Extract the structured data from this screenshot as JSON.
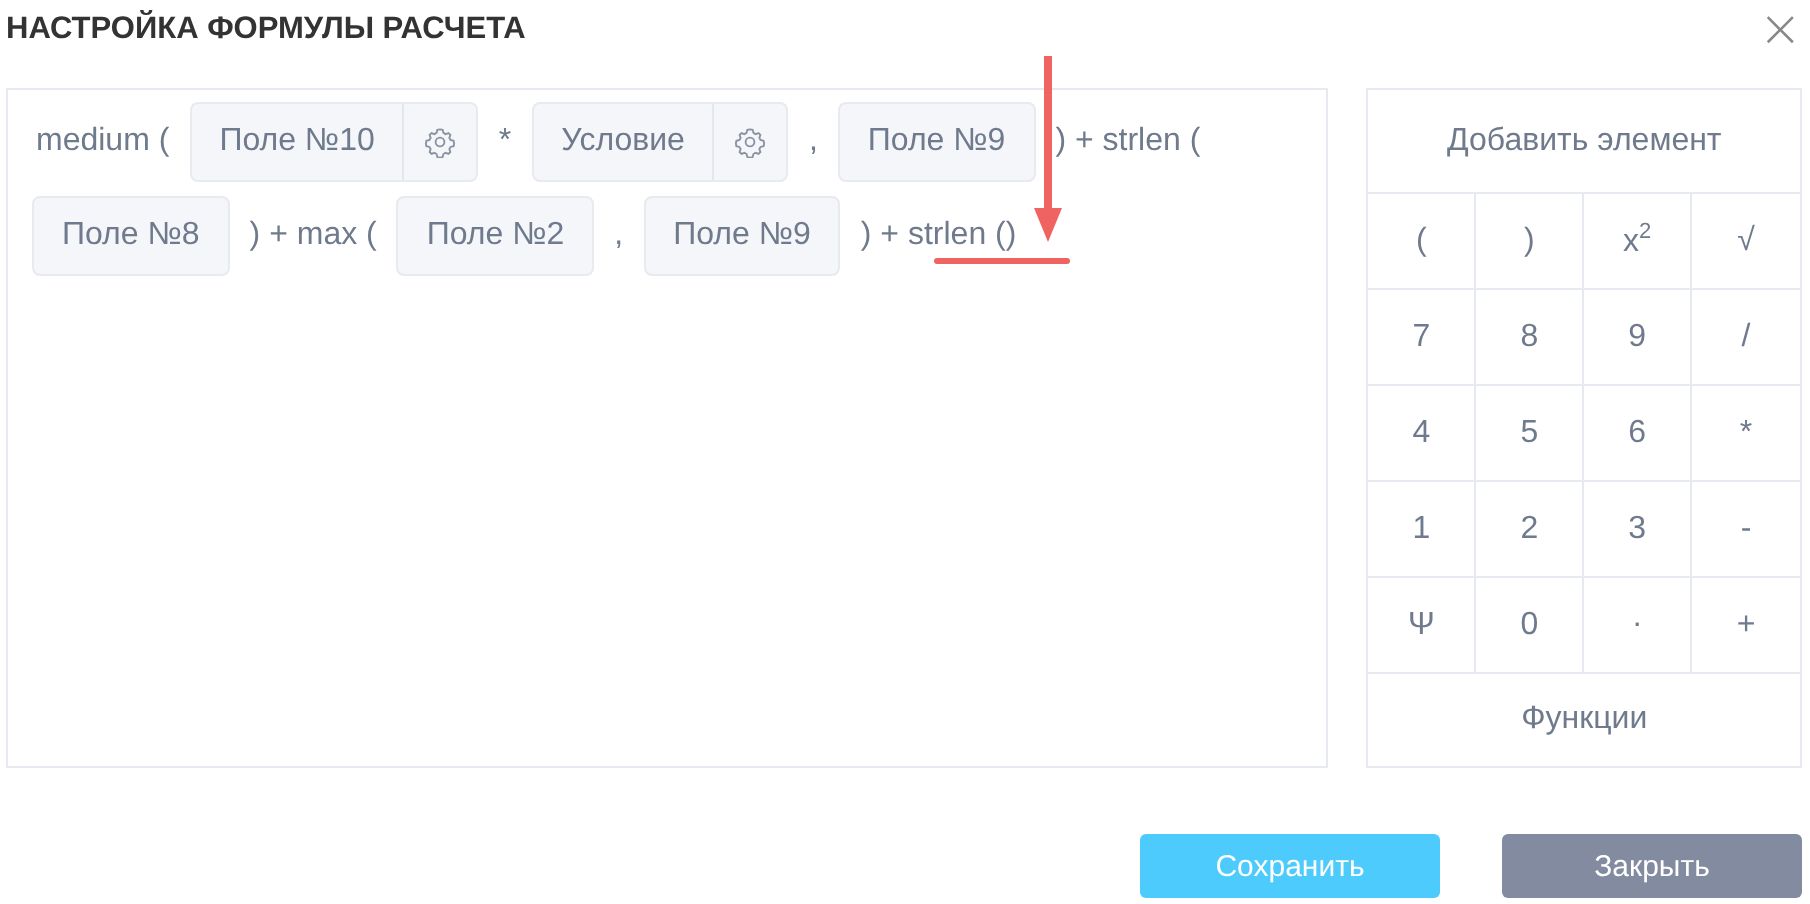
{
  "dialog": {
    "title": "НАСТРОЙКА ФОРМУЛЫ РАСЧЕТА",
    "close": "×"
  },
  "formula": [
    {
      "kind": "text",
      "text": "medium ("
    },
    {
      "kind": "field",
      "text": "Поле №10",
      "settings": true
    },
    {
      "kind": "text",
      "text": "*"
    },
    {
      "kind": "field",
      "text": "Условие",
      "settings": true
    },
    {
      "kind": "text",
      "text": ","
    },
    {
      "kind": "field",
      "text": "Поле №9",
      "settings": false
    },
    {
      "kind": "text",
      "text": ") + strlen ("
    },
    {
      "kind": "field",
      "text": "Поле №8",
      "settings": false
    },
    {
      "kind": "text",
      "text": ") + max ("
    },
    {
      "kind": "field",
      "text": "Поле №2",
      "settings": false
    },
    {
      "kind": "text",
      "text": ","
    },
    {
      "kind": "field",
      "text": "Поле №9",
      "settings": false
    },
    {
      "kind": "text",
      "text": ") + strlen ()"
    }
  ],
  "keypad": {
    "header": "Добавить элемент",
    "keys": [
      "(",
      ")",
      "x$^{2}$",
      "√",
      "7",
      "8",
      "9",
      "/",
      "4",
      "5",
      "6",
      "*",
      "1",
      "2",
      "3",
      "-",
      "Ψ",
      "0",
      ".",
      "+"
    ],
    "footer": "Функции"
  },
  "buttons": [
    {
      "kind": "primary",
      "label": "Сохранить"
    },
    {
      "kind": "secondary",
      "label": "Закрыть"
    }
  ]
}
